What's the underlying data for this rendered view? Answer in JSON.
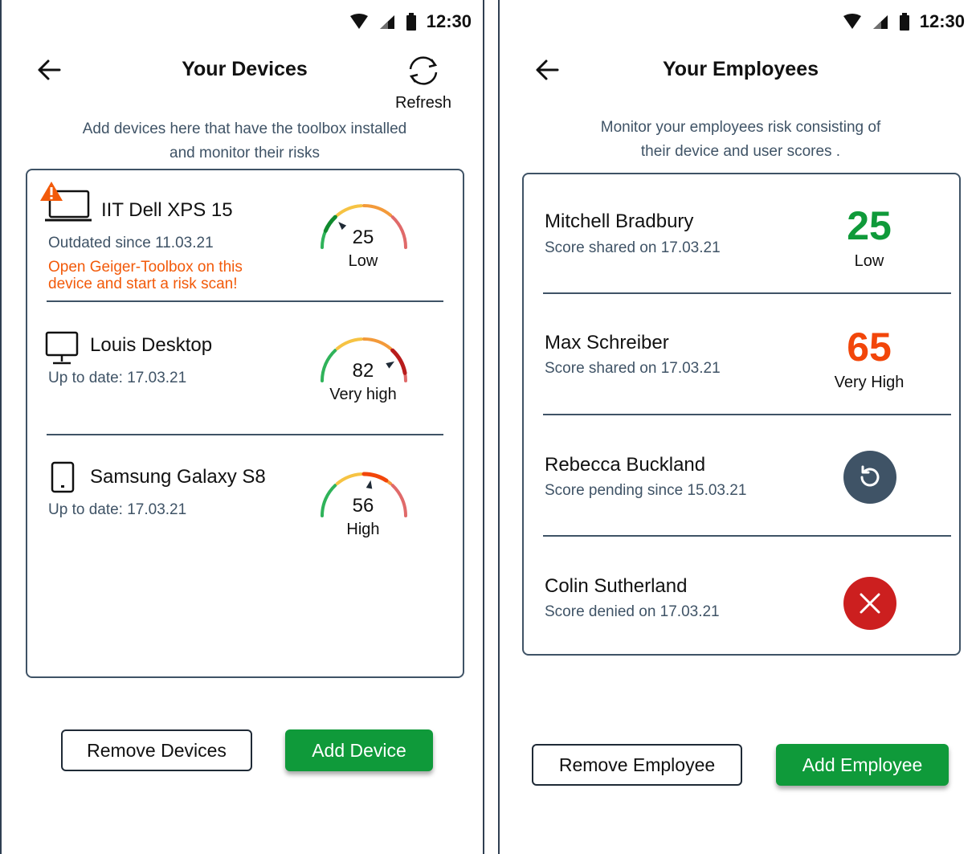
{
  "status": {
    "time": "12:30"
  },
  "devices_screen": {
    "title": "Your Devices",
    "refresh_label": "Refresh",
    "description": "Add devices here that have the toolbox installed and monitor their risks",
    "description_line1": "Add devices here that have the toolbox installed",
    "description_line2": "and monitor their risks",
    "devices": [
      {
        "name": "IIT Dell XPS 15",
        "status": "Outdated since 11.03.21",
        "warning_line1": "Open Geiger-Toolbox on this",
        "warning_line2": "device and start a risk scan!",
        "score": "25",
        "level": "Low",
        "icon": "laptop-warning-icon",
        "gauge_fraction": 0.25
      },
      {
        "name": "Louis Desktop",
        "status": "Up to date: 17.03.21",
        "score": "82",
        "level": "Very high",
        "icon": "desktop-icon",
        "gauge_fraction": 0.82
      },
      {
        "name": "Samsung Galaxy S8",
        "status": "Up to date: 17.03.21",
        "score": "56",
        "level": "High",
        "icon": "smartphone-icon",
        "gauge_fraction": 0.56
      }
    ],
    "remove_button": "Remove Devices",
    "add_button": "Add  Device"
  },
  "employees_screen": {
    "title": "Your Employees",
    "description_line1": "Monitor your employees risk consisting of",
    "description_line2": "their device and user scores .",
    "employees": [
      {
        "name": "Mitchell Bradbury",
        "status": "Score shared on 17.03.21",
        "score": "25",
        "level": "Low",
        "score_color": "#0f9a3a"
      },
      {
        "name": "Max Schreiber",
        "status": "Score shared on 17.03.21",
        "score": "65",
        "level": "Very High",
        "score_color": "#f2460a"
      },
      {
        "name": "Rebecca Buckland",
        "status": "Score pending since 15.03.21",
        "icon": "pending-refresh-icon"
      },
      {
        "name": "Colin Sutherland",
        "status": "Score denied on 17.03.21",
        "icon": "denied-x-icon"
      }
    ],
    "remove_button": "Remove Employee",
    "add_button": "Add Employee"
  },
  "colors": {
    "accent_green": "#0f9a3a",
    "warning_orange": "#f25a0a",
    "pending_slate": "#3f5366",
    "denied_red": "#cc1f1f"
  }
}
